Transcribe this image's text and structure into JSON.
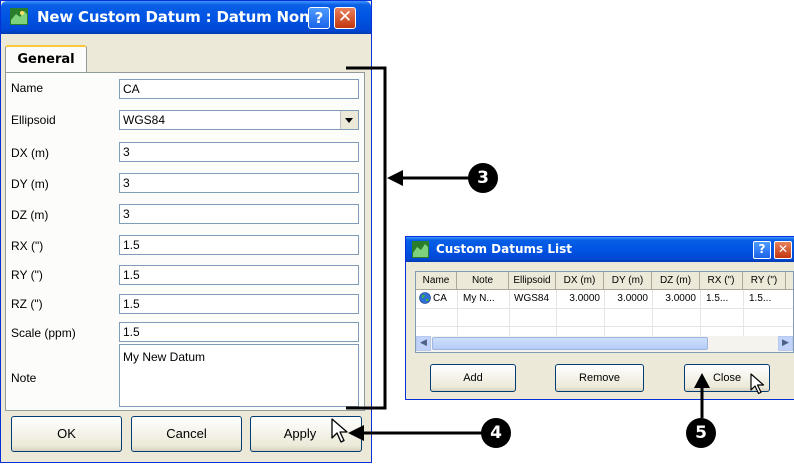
{
  "main_dialog": {
    "title": "New Custom Datum : Datum None",
    "help_label": "?",
    "close_label": "✕",
    "tab_label": "General",
    "fields": [
      {
        "label": "Name",
        "value": "CA"
      },
      {
        "label": "Ellipsoid",
        "value": "WGS84"
      },
      {
        "label": "DX (m)",
        "value": "3"
      },
      {
        "label": "DY (m)",
        "value": "3"
      },
      {
        "label": "DZ (m)",
        "value": "3"
      },
      {
        "label": "RX (\")",
        "value": "1.5"
      },
      {
        "label": "RY (\")",
        "value": "1.5"
      },
      {
        "label": "RZ (\")",
        "value": "1.5"
      },
      {
        "label": "Scale (ppm)",
        "value": "1.5"
      },
      {
        "label": "Note",
        "value": "My New Datum"
      }
    ],
    "buttons": {
      "ok": "OK",
      "cancel": "Cancel",
      "apply": "Apply"
    }
  },
  "list_window": {
    "title": "Custom Datums List",
    "help_label": "?",
    "close_label": "✕",
    "columns": [
      "Name",
      "Note",
      "Ellipsoid",
      "DX (m)",
      "DY (m)",
      "DZ (m)",
      "RX (\")",
      "RY (\")"
    ],
    "rows": [
      [
        "CA",
        "My N...",
        "WGS84",
        "3.0000",
        "3.0000",
        "3.0000",
        "1.5...",
        "1.5..."
      ]
    ],
    "scroll_left": "◀",
    "scroll_right": "▶",
    "buttons": {
      "add": "Add",
      "remove": "Remove",
      "close": "Close"
    }
  },
  "callouts": [
    "3",
    "4",
    "5"
  ],
  "icons": {
    "app_icon": "map-app-icon",
    "row_icon": "globe-icon",
    "cursor": "mouse-pointer-icon"
  }
}
